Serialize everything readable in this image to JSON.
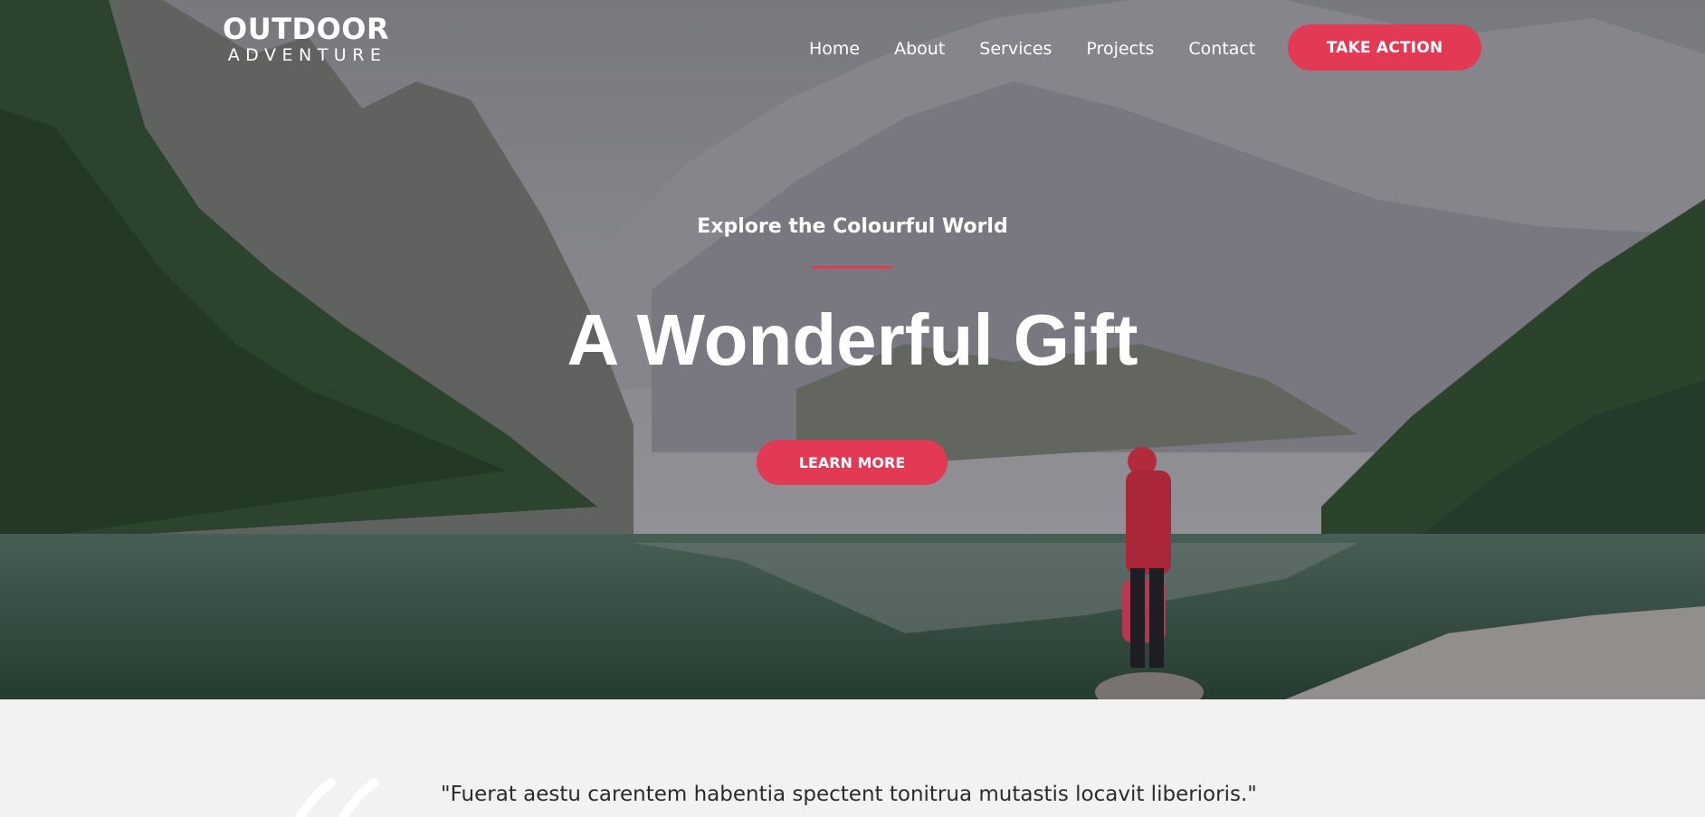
{
  "brand": {
    "name_main": "OUTDOOR",
    "name_sub": "ADVENTURE"
  },
  "nav": {
    "items": [
      {
        "label": "Home"
      },
      {
        "label": "About"
      },
      {
        "label": "Services"
      },
      {
        "label": "Projects"
      },
      {
        "label": "Contact"
      }
    ],
    "cta_label": "TAKE ACTION"
  },
  "hero": {
    "eyebrow": "Explore the Colourful World",
    "headline": "A Wonderful Gift",
    "button_label": "LEARN MORE",
    "background": "mountain-lake-photo"
  },
  "testimonial": {
    "quote": "\"Fuerat aestu carentem habentia spectent tonitrua mutastis locavit liberioris.\"",
    "icon": "quote-mark-icon"
  },
  "colors": {
    "accent": "#e23a55",
    "text_light": "#ffffff",
    "section_bg": "#f4f1f1"
  }
}
